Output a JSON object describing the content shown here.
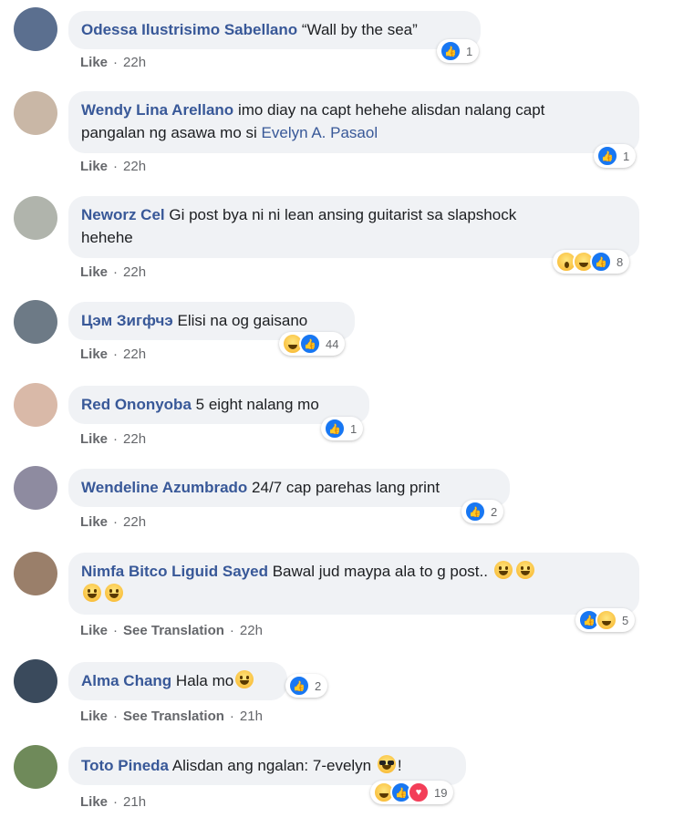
{
  "action_like": "Like",
  "action_translate": "See Translation",
  "colors": {
    "link": "#385898",
    "bubble": "#f0f2f5",
    "like_blue": "#1877f2",
    "love_red": "#f33e58"
  },
  "comments": [
    {
      "author": "Odessa Ilustrisimo Sabellano",
      "text1": "“Wall by the sea”",
      "time": "22h",
      "reaction_count": "1",
      "avatar_color": "#5b6f8f"
    },
    {
      "author": "Wendy Lina Arellano",
      "text1": "imo diay na capt hehehe alisdan nalang capt",
      "text2": "pangalan ng asawa mo si",
      "mention": "Evelyn A. Pasaol",
      "time": "22h",
      "reaction_count": "1",
      "avatar_color": "#c9b7a6"
    },
    {
      "author": "Neworz Cel",
      "text1": "Gi post bya ni ni lean ansing guitarist sa slapshock",
      "text2": "hehehe",
      "time": "22h",
      "reaction_count": "8",
      "avatar_color": "#b0b4ac"
    },
    {
      "author": "Цэм Зигфчэ",
      "text1": "Elisi na og gaisano",
      "time": "22h",
      "reaction_count": "44",
      "avatar_color": "#6d7a86"
    },
    {
      "author": "Red Ononyoba",
      "text1": "5 eight nalang mo",
      "time": "22h",
      "reaction_count": "1",
      "avatar_color": "#d9b9a8"
    },
    {
      "author": "Wendeline Azumbrado",
      "text1": "24/7 cap parehas lang print",
      "time": "22h",
      "reaction_count": "2",
      "avatar_color": "#8e8ba0"
    },
    {
      "author": "Nimfa Bitco Liguid Sayed",
      "text1": "Bawal jud maypa ala to g post..",
      "time": "22h",
      "reaction_count": "5",
      "avatar_color": "#9a7f6a"
    },
    {
      "author": "Alma Chang",
      "text1": "Hala mo",
      "time": "21h",
      "reaction_count": "2",
      "avatar_color": "#3a4a5c"
    },
    {
      "author": "Toto Pineda",
      "text1": "Alisdan ang ngalan: 7-evelyn",
      "text_end": "!",
      "time": "21h",
      "reaction_count": "19",
      "avatar_color": "#6f8a5a"
    }
  ],
  "icons": [
    "like-reaction-icon",
    "haha-reaction-icon",
    "wow-reaction-icon",
    "love-reaction-icon",
    "grinning-emoji-icon",
    "sunglasses-emoji-icon"
  ]
}
